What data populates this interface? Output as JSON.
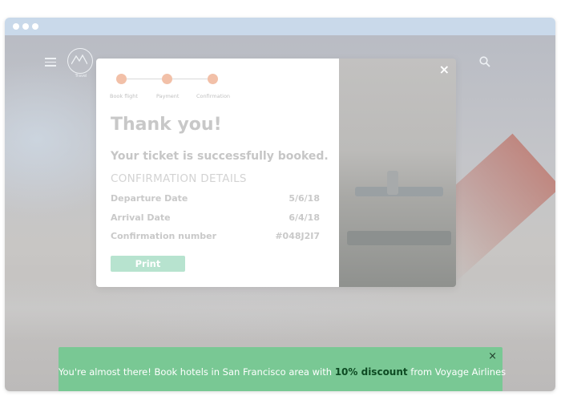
{
  "app": {
    "logo_text": "Travel"
  },
  "steps": [
    {
      "label": "Book flight"
    },
    {
      "label": "Payment"
    },
    {
      "label": "Confirmation"
    }
  ],
  "modal": {
    "close_glyph": "×",
    "title": "Thank you!",
    "subtitle": "Your ticket is successfully booked.",
    "section_heading": "CONFIRMATION DETAILS",
    "details": [
      {
        "label": "Departure Date",
        "value": "5/6/18"
      },
      {
        "label": "Arrival Date",
        "value": "6/4/18"
      },
      {
        "label": "Confirmation number",
        "value": "#048J2I7"
      }
    ],
    "print_label": "Print"
  },
  "banner": {
    "text_before": "You're almost there! Book hotels in San Francisco area with ",
    "highlight": "10% discount",
    "text_after": " from Voyage Airlines",
    "close_glyph": "×"
  },
  "colors": {
    "accent_green": "#79c894",
    "step_dot": "#f2c0a8",
    "print_button": "#b7e3cf",
    "browser_bar": "#c9d9ea"
  },
  "icons": {
    "menu": "hamburger-menu-icon",
    "logo": "mountain-logo-icon",
    "search": "search-icon",
    "close": "close-icon"
  }
}
